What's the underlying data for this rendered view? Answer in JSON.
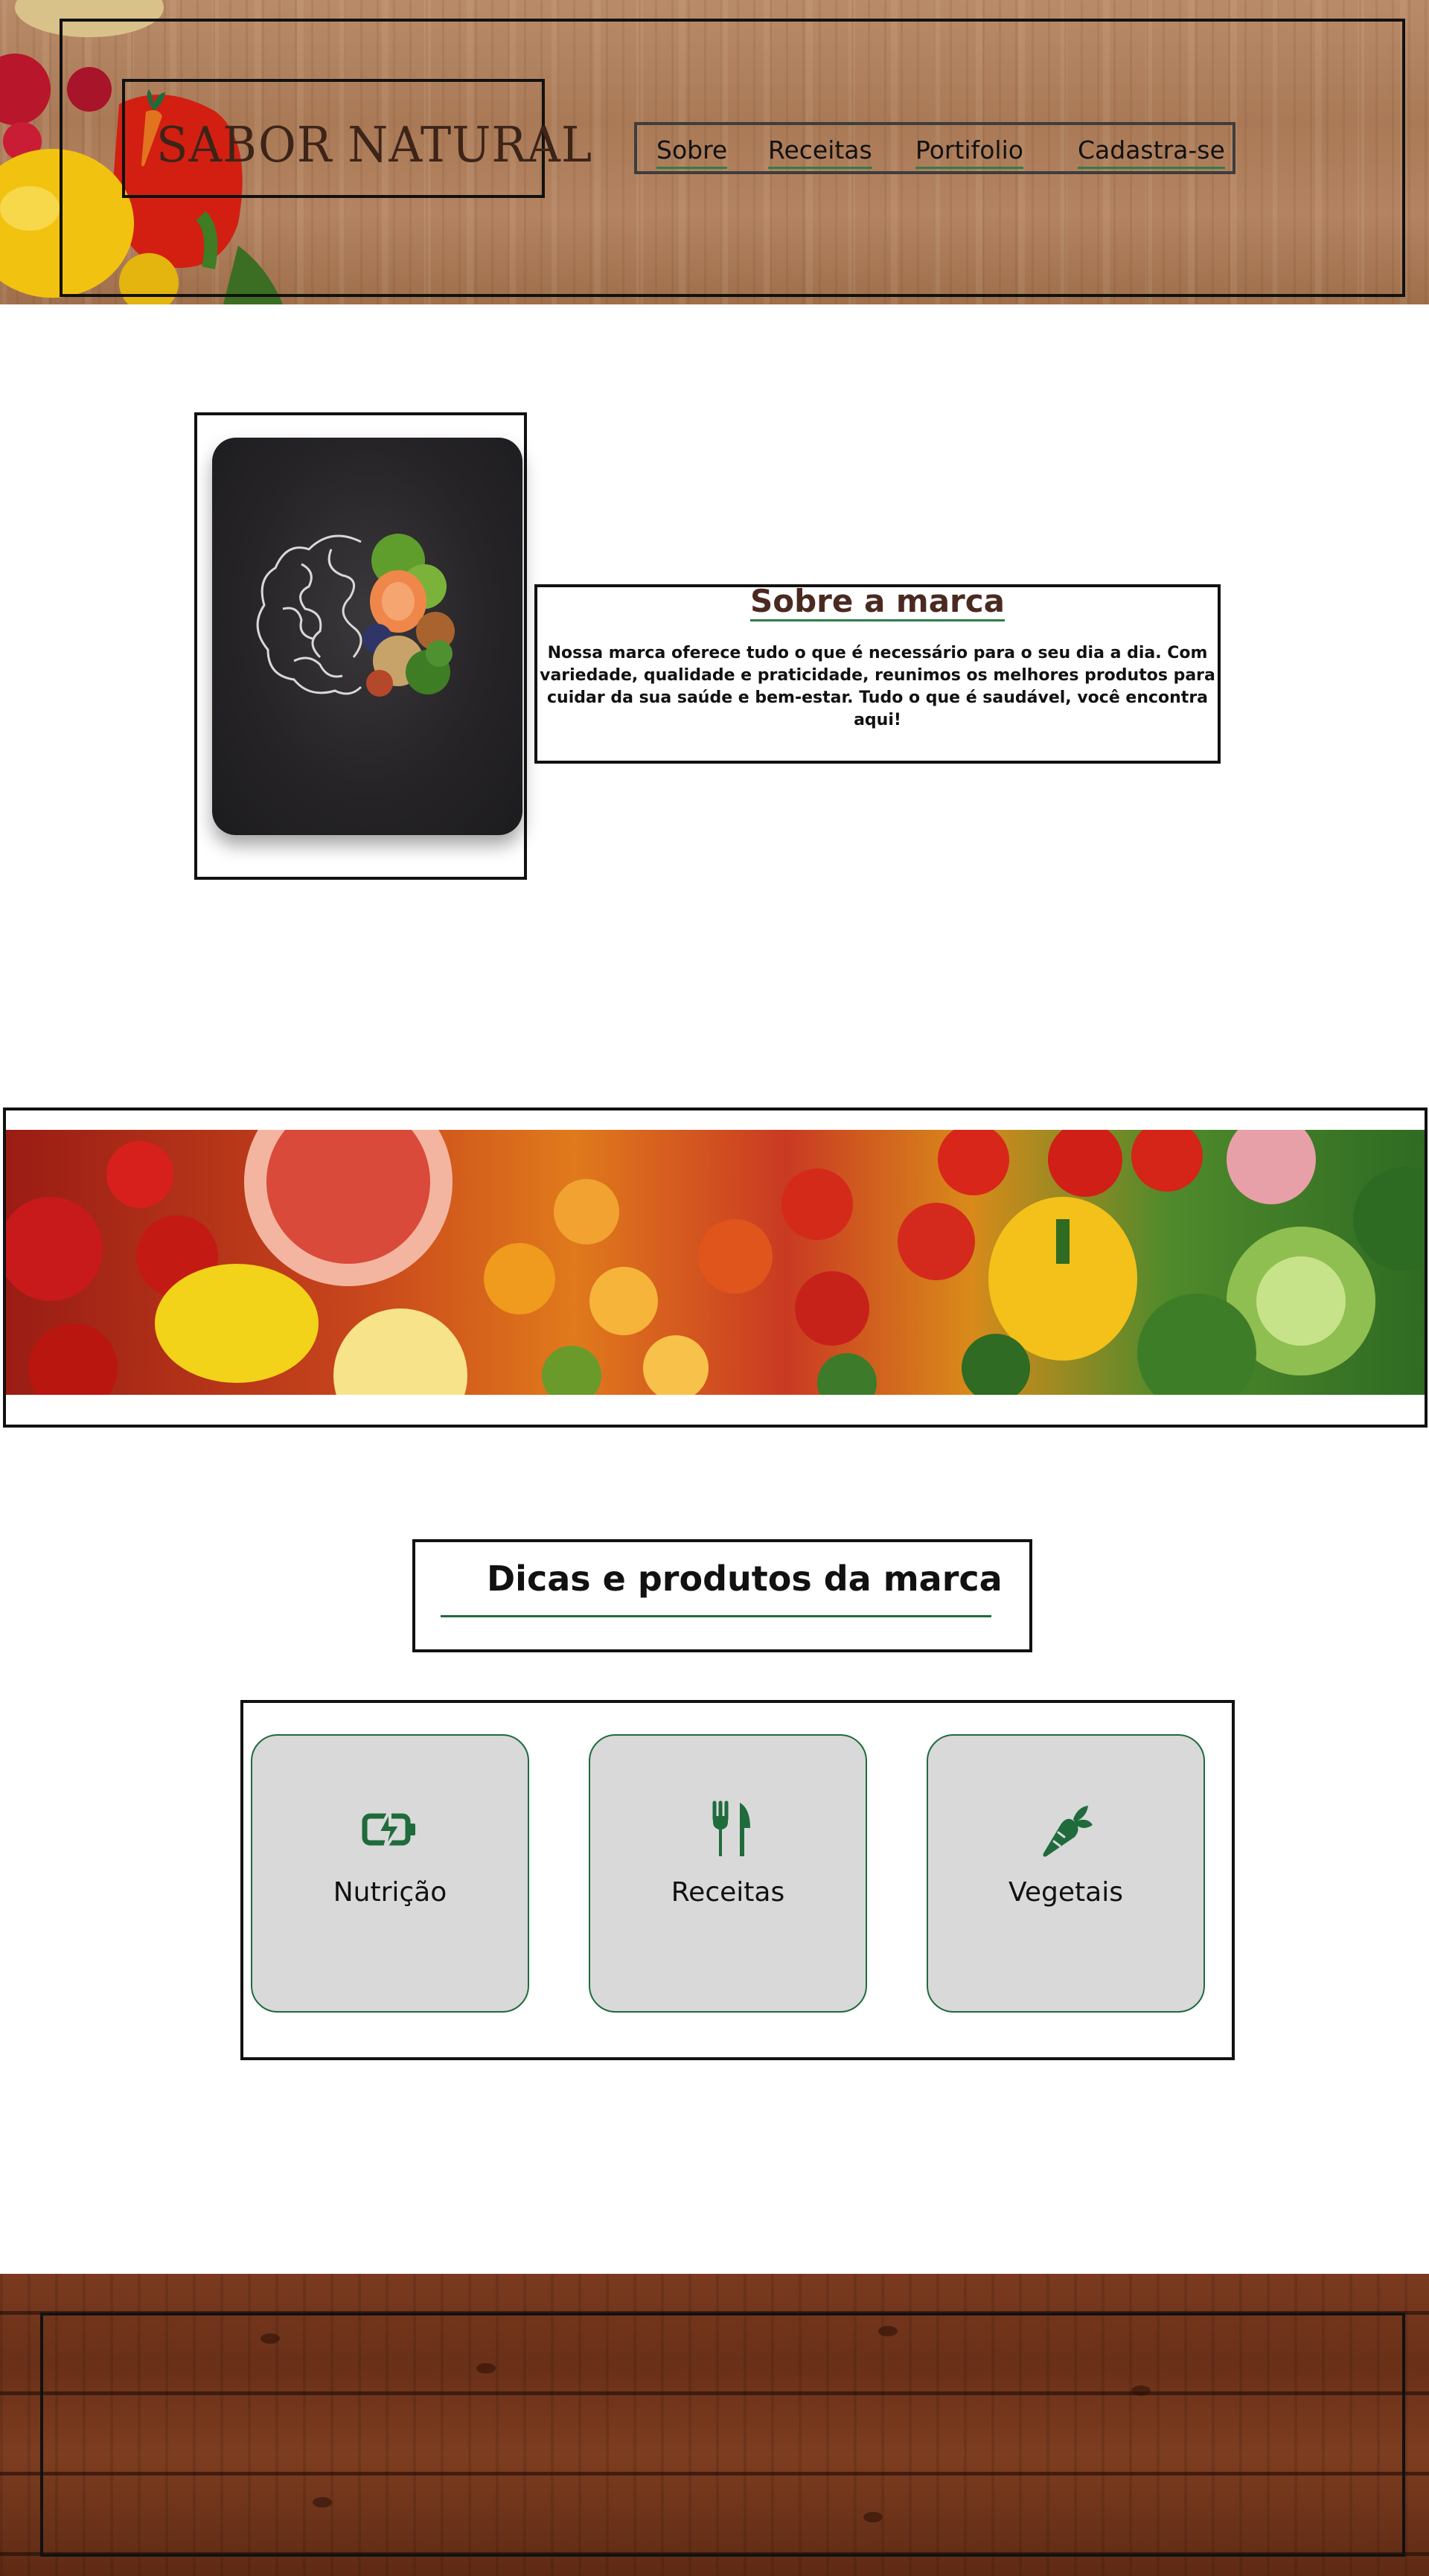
{
  "header": {
    "logo_text": "SABOR NATURAL",
    "nav": [
      {
        "label": "Sobre"
      },
      {
        "label": "Receitas"
      },
      {
        "label": "Portifolio"
      },
      {
        "label": "Cadastra-se"
      }
    ]
  },
  "about": {
    "title": "Sobre a marca",
    "body": "Nossa marca oferece tudo o que é necessário para o seu dia a dia. Com variedade, qualidade e praticidade, reunimos os melhores produtos para cuidar da sua saúde e bem-estar. Tudo o que é saudável, você encontra aqui!"
  },
  "tips": {
    "title": "Dicas e produtos da marca",
    "cards": [
      {
        "label": "Nutrição",
        "icon": "battery-bolt-icon"
      },
      {
        "label": "Receitas",
        "icon": "fork-knife-icon"
      },
      {
        "label": "Vegetais",
        "icon": "carrot-icon"
      }
    ]
  },
  "colors": {
    "accent_green": "#1f6b3c",
    "title_brown": "#4a2a20",
    "card_bg": "#d9d9d9"
  }
}
